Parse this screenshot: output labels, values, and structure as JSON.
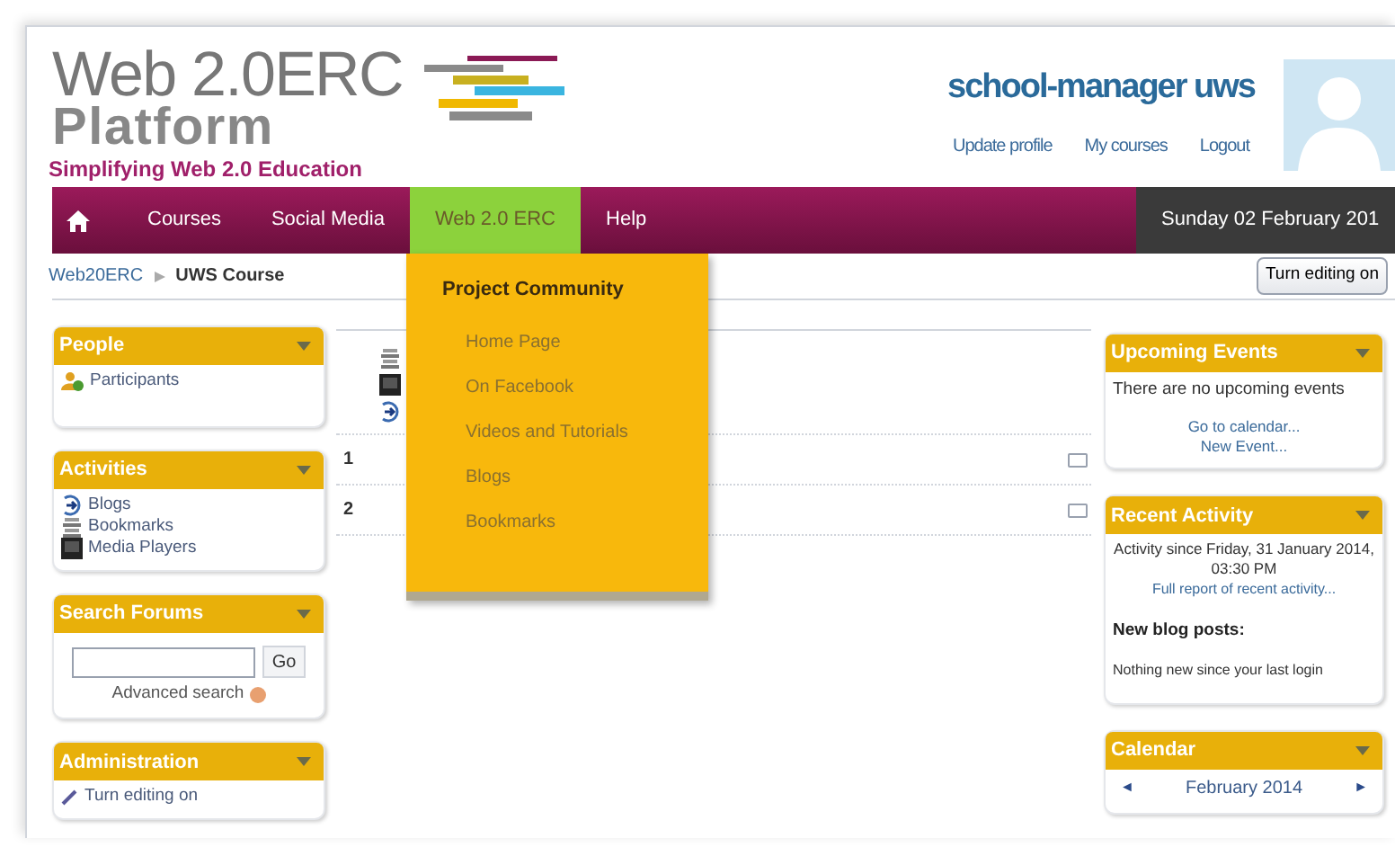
{
  "logo": {
    "title": "Web 2.0ERC",
    "subtitle": "Platform",
    "tagline": "Simplifying Web 2.0 Education"
  },
  "user": {
    "name": "school-manager uws",
    "links": [
      "Update profile",
      "My courses",
      "Logout"
    ]
  },
  "nav": {
    "items": [
      {
        "kind": "home",
        "selected": false
      },
      {
        "label": "Courses",
        "selected": false
      },
      {
        "label": "Social Media",
        "selected": false
      },
      {
        "label": "Web 2.0 ERC",
        "selected": true
      },
      {
        "label": "Help",
        "selected": false
      }
    ],
    "date": "Sunday 02 February 201"
  },
  "breadcrumb": [
    "Web20ERC",
    "UWS Course"
  ],
  "edit_button": "Turn editing on",
  "dropdown": {
    "heading": "Project Community",
    "items": [
      "Home Page",
      "On Facebook",
      "Videos and Tutorials",
      "Blogs",
      "Bookmarks"
    ]
  },
  "left_blocks": [
    {
      "title": "People",
      "kind": "list",
      "items": [
        {
          "label": "Participants",
          "kind": "people"
        }
      ]
    },
    {
      "title": "Activities",
      "kind": "list",
      "items": [
        {
          "label": "Blogs",
          "kind": "blog"
        },
        {
          "label": "Bookmarks",
          "kind": "bookmark"
        },
        {
          "label": "Media Players",
          "kind": "media"
        }
      ]
    },
    {
      "title": "Search Forums",
      "kind": "search",
      "button": "Go",
      "link": "Advanced search"
    },
    {
      "title": "Administration",
      "kind": "list",
      "items": [
        {
          "label": "Turn editing on",
          "kind": "edit"
        }
      ]
    }
  ],
  "center": {
    "activities": [
      {
        "kind": "bookmark"
      },
      {
        "kind": "media"
      },
      {
        "kind": "blog"
      }
    ],
    "sections": [
      "1",
      "2"
    ]
  },
  "right_blocks": [
    {
      "title": "Upcoming Events",
      "kind": "events",
      "text": "There are no upcoming events",
      "links": [
        "Go to calendar...",
        "New Event..."
      ]
    },
    {
      "title": "Recent Activity",
      "kind": "recent",
      "text": "Activity since Friday, 31 January 2014, 03:30 PM",
      "link": "Full report of recent activity...",
      "heading": "New blog posts:",
      "note": "Nothing new since your last login"
    },
    {
      "title": "Calendar",
      "kind": "calendar",
      "month": "February 2014",
      "prev": "◄",
      "next": "►"
    }
  ]
}
